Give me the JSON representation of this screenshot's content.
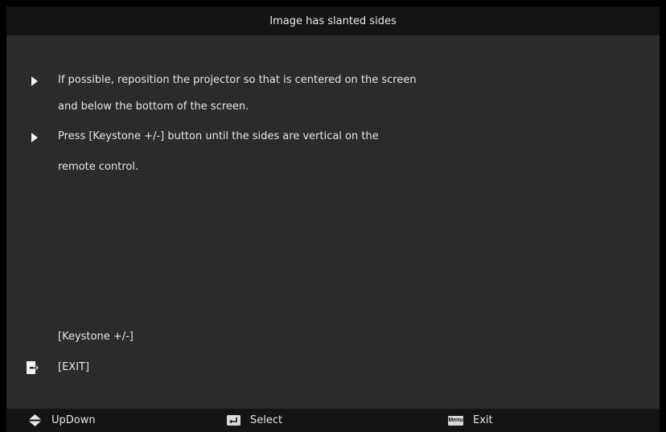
{
  "window": {
    "title": "Image has slanted sides"
  },
  "tips": [
    {
      "line1": "If possible, reposition the projector so that is centered on the screen",
      "line2": "and below the bottom of the screen."
    },
    {
      "line1": "Press [Keystone +/-] button until the sides are vertical on the",
      "line2": "remote control."
    }
  ],
  "actions": {
    "keystone_label": "[Keystone +/-]",
    "exit_label": "[EXIT]"
  },
  "footer": {
    "updown_label": "UpDown",
    "select_label": "Select",
    "menu_key_text": "Menu",
    "exit_label": "Exit"
  },
  "icons": {
    "tip_arrow": "triangle-right-icon",
    "exit": "exit-door-icon",
    "updown": "up-down-arrows-icon",
    "select": "enter-key-icon",
    "menu": "menu-key-icon"
  }
}
